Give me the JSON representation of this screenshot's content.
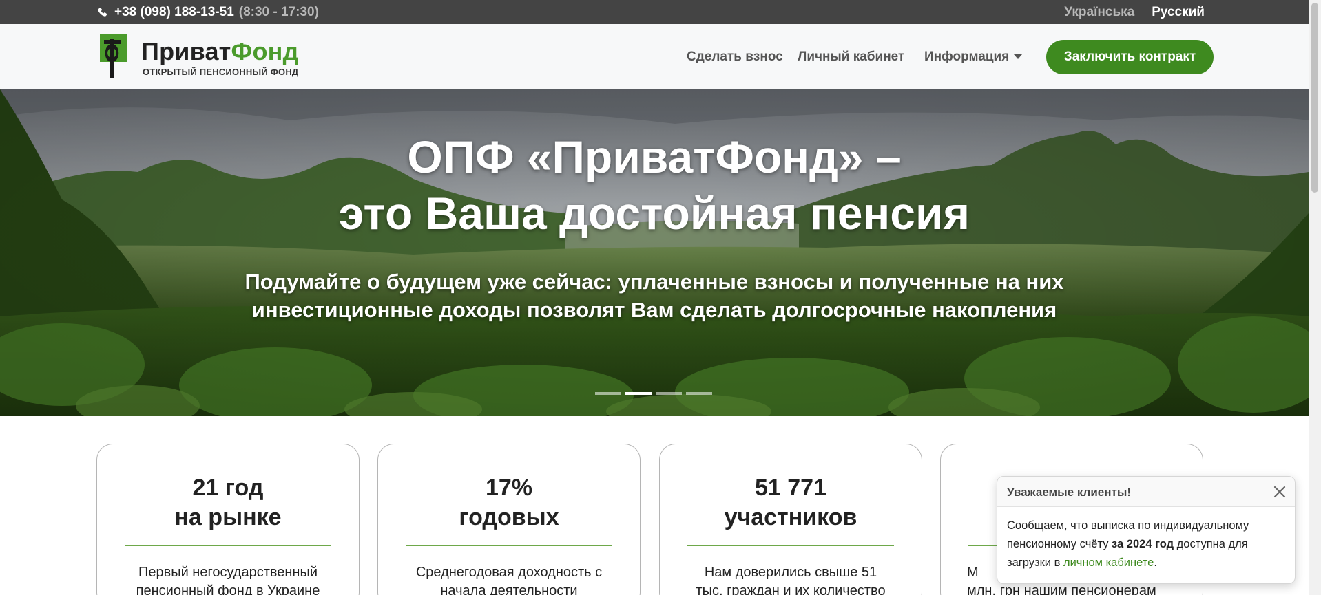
{
  "topbar": {
    "phone": "+38 (098) 188-13-51",
    "hours": "(8:30 - 17:30)",
    "languages": [
      {
        "label": "Українська",
        "active": false
      },
      {
        "label": "Русский",
        "active": true
      }
    ]
  },
  "header": {
    "logo_name_part1": "Приват",
    "logo_name_part2": "Фонд",
    "logo_subtitle": "ОТКРЫТЫЙ ПЕНСИОННЫЙ ФОНД",
    "nav": [
      {
        "label": "Сделать взнос"
      },
      {
        "label": "Личный кабинет"
      },
      {
        "label": "Информация",
        "dropdown": true
      }
    ],
    "cta_label": "Заключить контракт"
  },
  "hero": {
    "title_line1": "ОПФ «ПриватФонд» –",
    "title_line2": "это Ваша достойная пенсия",
    "subtitle": "Подумайте о будущем уже сейчас: уплаченные взносы и полученные на них инвестиционные доходы позволят Вам сделать долгосрочные накопления",
    "slides_count": 4,
    "active_slide": 2
  },
  "stats": [
    {
      "line1": "21 год",
      "line2": "на рынке",
      "desc_line1": "Первый негосударственный",
      "desc_line2": "пенсионный фонд в Украине"
    },
    {
      "line1": "17%",
      "line2": "годовых",
      "desc_line1": "Среднегодовая доходность с",
      "desc_line2": "начала деятельности"
    },
    {
      "line1": "51 771",
      "line2": "участников",
      "desc_line1": "Нам доверились свыше 51",
      "desc_line2": "тыс. граждан и их количество"
    },
    {
      "line1": "",
      "line2": "",
      "desc_line1": "М",
      "desc_line2": "млн. грн нашим пенсионерам"
    }
  ],
  "toast": {
    "title": "Уважаемые клиенты!",
    "text_before": "Сообщаем, что выписка по индивидуальному пенсионному счёту ",
    "text_bold": "за 2024 год",
    "text_middle": " доступна для загрузки в ",
    "link_text": "личном кабинете",
    "text_after": "."
  },
  "colors": {
    "topbar_bg": "#444444",
    "brand_green": "#3e8a1f",
    "navbar_bg": "#f7f8f9"
  }
}
